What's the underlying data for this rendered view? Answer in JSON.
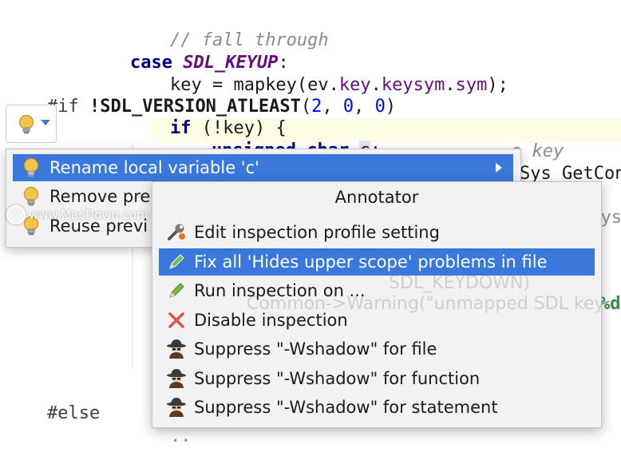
{
  "code": {
    "line1_comment": "// fall through",
    "line2_case": "case",
    "line2_const": "SDL_KEYUP",
    "line2_colon": ":",
    "line3_prefix": "key = mapkey(ev.",
    "line3_key": "key",
    "line3_dot1": ".",
    "line3_keysym": "keysym",
    "line3_dot2": ".",
    "line3_sym": "sym",
    "line3_suffix": ");",
    "line4_directive": "#if",
    "line4_space": " ",
    "line4_bang": "!",
    "line4_macro": "SDL_VERSION_ATLEAST",
    "line4_open": "(",
    "line4_n1": "2",
    "line4_sep1": ", ",
    "line4_n2": "0",
    "line4_sep2": ", ",
    "line4_n3": "0",
    "line4_close": ")",
    "line5_if": "if",
    "line5_rest": " (!key) {",
    "line6_unsigned": "unsigned",
    "line6_char": "char",
    "line6_var": "c",
    "line6_semi": ";",
    "ghost_keyword": "e key",
    "ghost_getcon": "Sys_GetCon",
    "ghost_sys": "(c = Sys_",
    "ghost_sdl_keydown": "SDL_KEYDOWN)",
    "ghost_warning": "Common->Warning(\"unmapped SDL key",
    "ghost_pct_d": "%d",
    "brace_close": "}",
    "else_directive": "#else",
    "ellipsis": ".."
  },
  "intentions_menu": {
    "items": [
      {
        "label": "Rename local variable 'c'",
        "icon": "bulb-icon"
      },
      {
        "label": "Remove pre",
        "icon": "bulb-icon"
      },
      {
        "label": "Reuse previ",
        "icon": "bulb-icon"
      }
    ]
  },
  "annotator_menu": {
    "title": "Annotator",
    "items": [
      {
        "label": "Edit inspection profile setting",
        "icon": "wrench-icon"
      },
      {
        "label": "Fix all 'Hides upper scope' problems in file",
        "icon": "pencil-icon"
      },
      {
        "label": "Run inspection on ...",
        "icon": "pencil-icon"
      },
      {
        "label": "Disable inspection",
        "icon": "close-icon"
      },
      {
        "label": "Suppress \"-Wshadow\" for file",
        "icon": "spy-icon"
      },
      {
        "label": "Suppress \"-Wshadow\" for function",
        "icon": "spy-icon"
      },
      {
        "label": "Suppress \"-Wshadow\" for statement",
        "icon": "spy-icon"
      }
    ]
  },
  "watermark": "www.MacDown.com",
  "colors": {
    "selection": "#3a78dc",
    "keyword": "#000080",
    "macro": "#660e7a",
    "number": "#0000ff",
    "comment": "#8c8c8c"
  }
}
